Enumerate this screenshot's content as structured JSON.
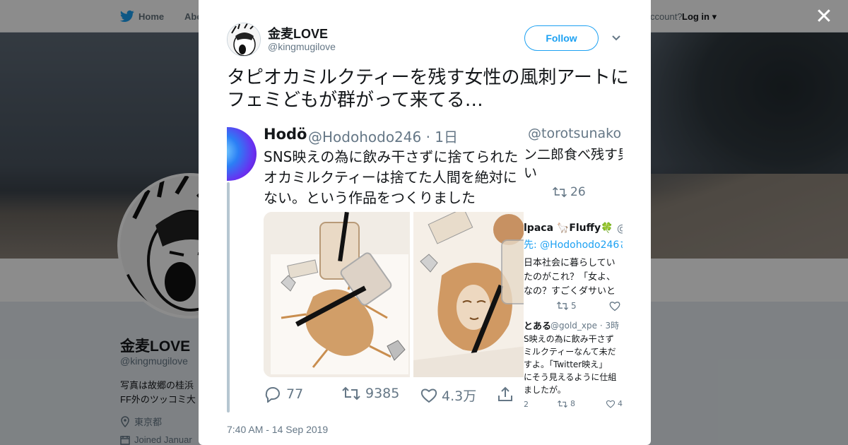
{
  "background": {
    "nav": {
      "home": "Home",
      "about": "Abo",
      "account": "ccount?",
      "login": "Log in"
    },
    "profile": {
      "name": "金麦LOVE",
      "handle": "@kingmugilove",
      "bio_line1": "写真は故郷の桂浜",
      "bio_line2": "FF外のツッコミ大",
      "location": "東京都",
      "joined": "Joined Januar"
    }
  },
  "modal": {
    "author": {
      "name": "金麦LOVE",
      "handle": "@kingmugilove"
    },
    "follow_label": "Follow",
    "tweet_text": "タピオカミルクティーを残す女性の風刺アートにフェミどもが群がって来てる…",
    "timestamp": "7:40 AM - 14 Sep 2019"
  },
  "embedded": {
    "name": "Hodö",
    "handle_time": "@Hodohodo246 · 1日",
    "line1": "SNS映えの為に飲み干さずに捨てられた",
    "line2": "オカミルクティーは捨てた人間を絶対に",
    "line3": "ない。という作品をつくりました",
    "replies": "77",
    "retweets": "9385",
    "likes": "4.3万",
    "right": {
      "handle": "@torotsunako ·",
      "text1": "ン二郎食べ残す男",
      "text2": "い",
      "rt_count": "26",
      "reply2_name": "lpaca 🦙Fluffy🍀",
      "reply2_at": "@",
      "reply2_to": "先: @Hodohodo246さ",
      "reply2_l1": "日本社会に暮らしてい",
      "reply2_l2": "たのがこれ？「女よ、",
      "reply2_l3": "なの？すごくダサいと",
      "reply2_rt": "5",
      "reply3_name": "とある",
      "reply3_handle": "@gold_xpe · 3時",
      "reply3_l1": "S映えの為に飲み干さず",
      "reply3_l2": "ミルクティーなんて未だ",
      "reply3_l3": "すよ。「Twitter映え」",
      "reply3_l4": "にそう見えるように仕組",
      "reply3_l5": "ましたが。",
      "reply3_rep": "2",
      "reply3_rt": "8",
      "reply3_like": "4"
    }
  },
  "colors": {
    "twitter_blue": "#1da1f2",
    "text_dark": "#14171a",
    "text_gray": "#657786"
  },
  "icons": [
    "twitter-bird-icon",
    "close-icon",
    "chevron-down-icon",
    "reply-icon",
    "retweet-icon",
    "like-icon",
    "share-icon",
    "location-icon",
    "calendar-icon"
  ]
}
